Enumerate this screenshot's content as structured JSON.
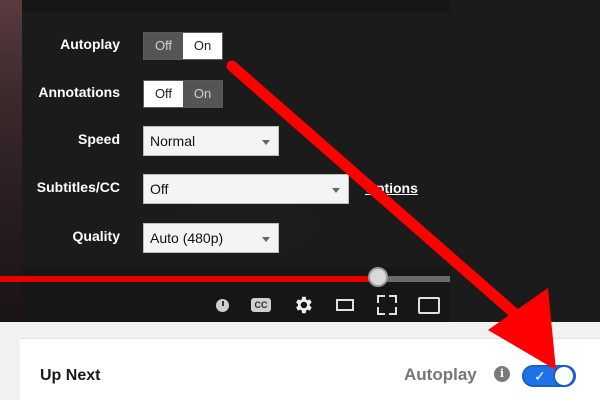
{
  "settings": {
    "autoplay": {
      "label": "Autoplay",
      "off": "Off",
      "on": "On",
      "selected": "On"
    },
    "annotations": {
      "label": "Annotations",
      "off": "Off",
      "on": "On",
      "selected": "Off"
    },
    "speed": {
      "label": "Speed",
      "value": "Normal"
    },
    "subtitles": {
      "label": "Subtitles/CC",
      "value": "Off",
      "options_link": "Options"
    },
    "quality": {
      "label": "Quality",
      "value": "Auto (480p)"
    }
  },
  "player": {
    "progress_fraction": 0.84,
    "cc_label": "CC",
    "icons": [
      "clock-icon",
      "cc-icon",
      "gear-icon",
      "theater-mode-icon",
      "fullscreen-icon",
      "cast-icon"
    ]
  },
  "up_next": {
    "title": "Up Next",
    "autoplay_label": "Autoplay",
    "info_glyph": "i",
    "autoplay_enabled": true,
    "check_glyph": "✓"
  },
  "colors": {
    "progress_red": "#e60000",
    "toggle_blue": "#1e73e8",
    "arrow_red": "#ff0000"
  }
}
